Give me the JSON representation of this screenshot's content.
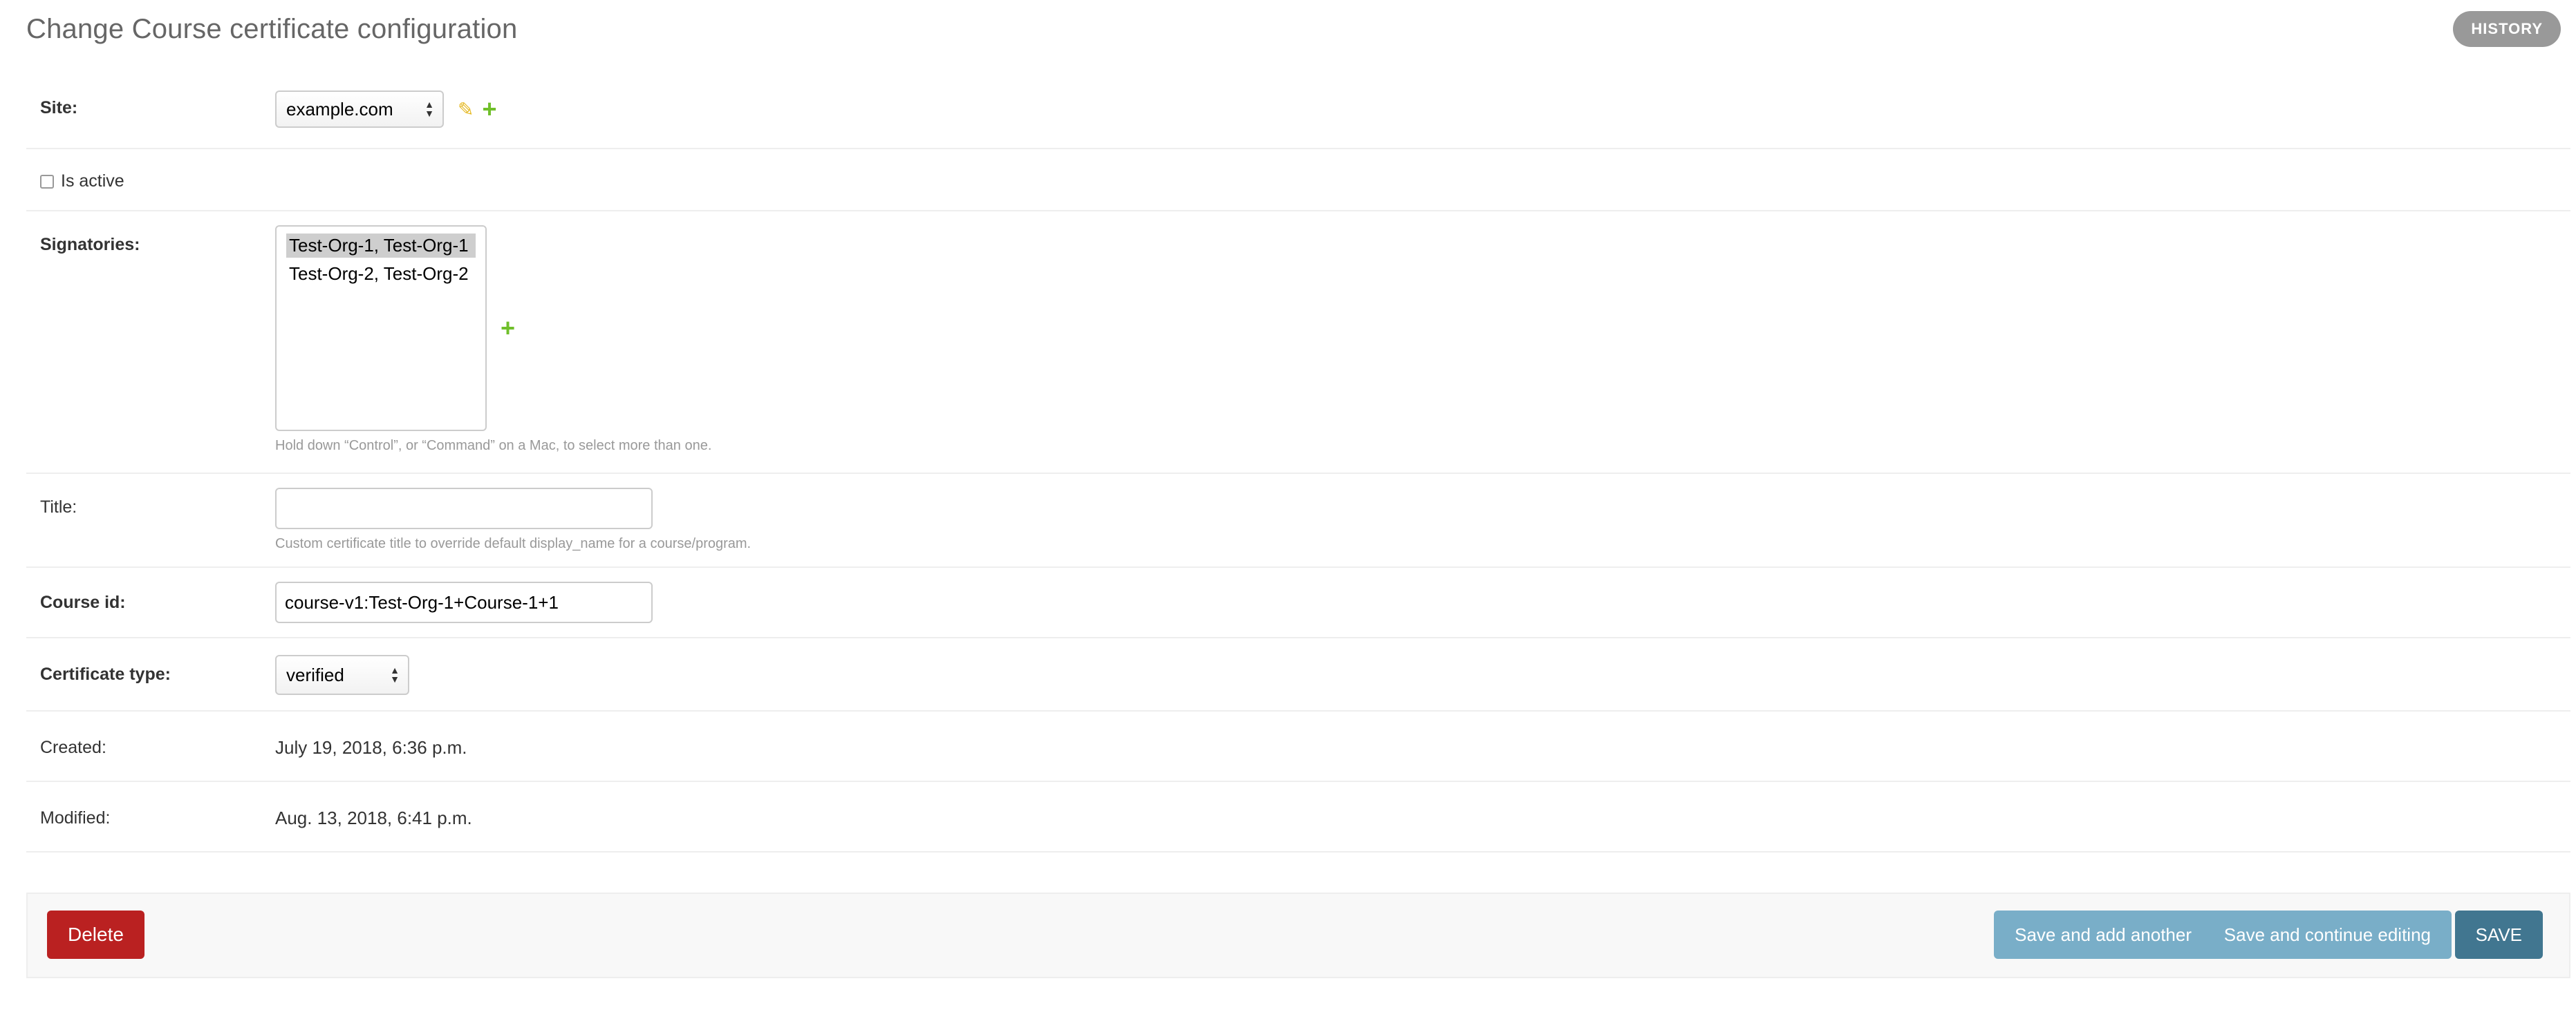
{
  "header": {
    "title": "Change Course certificate configuration",
    "history_label": "HISTORY"
  },
  "form": {
    "site": {
      "label": "Site:",
      "value": "example.com"
    },
    "is_active": {
      "label": "Is active",
      "checked": false
    },
    "signatories": {
      "label": "Signatories:",
      "options": [
        "Test-Org-1, Test-Org-1",
        "Test-Org-2, Test-Org-2"
      ],
      "selected_index": 0,
      "help": "Hold down “Control”, or “Command” on a Mac, to select more than one."
    },
    "title": {
      "label": "Title:",
      "value": "",
      "help": "Custom certificate title to override default display_name for a course/program."
    },
    "course_id": {
      "label": "Course id:",
      "value": "course-v1:Test-Org-1+Course-1+1"
    },
    "certificate_type": {
      "label": "Certificate type:",
      "value": "verified"
    },
    "created": {
      "label": "Created:",
      "value": "July 19, 2018, 6:36 p.m."
    },
    "modified": {
      "label": "Modified:",
      "value": "Aug. 13, 2018, 6:41 p.m."
    }
  },
  "actions": {
    "delete_label": "Delete",
    "save_add_another_label": "Save and add another",
    "save_continue_label": "Save and continue editing",
    "save_label": "SAVE"
  },
  "colors": {
    "delete": "#ba2121",
    "secondary_button": "#79aec8",
    "save_button": "#417690",
    "plus_icon": "#70bf2b",
    "pencil_icon": "#e5b820"
  },
  "icons": {
    "edit": "pencil-icon",
    "add": "plus-icon",
    "select_arrows": "select-arrows-icon"
  }
}
